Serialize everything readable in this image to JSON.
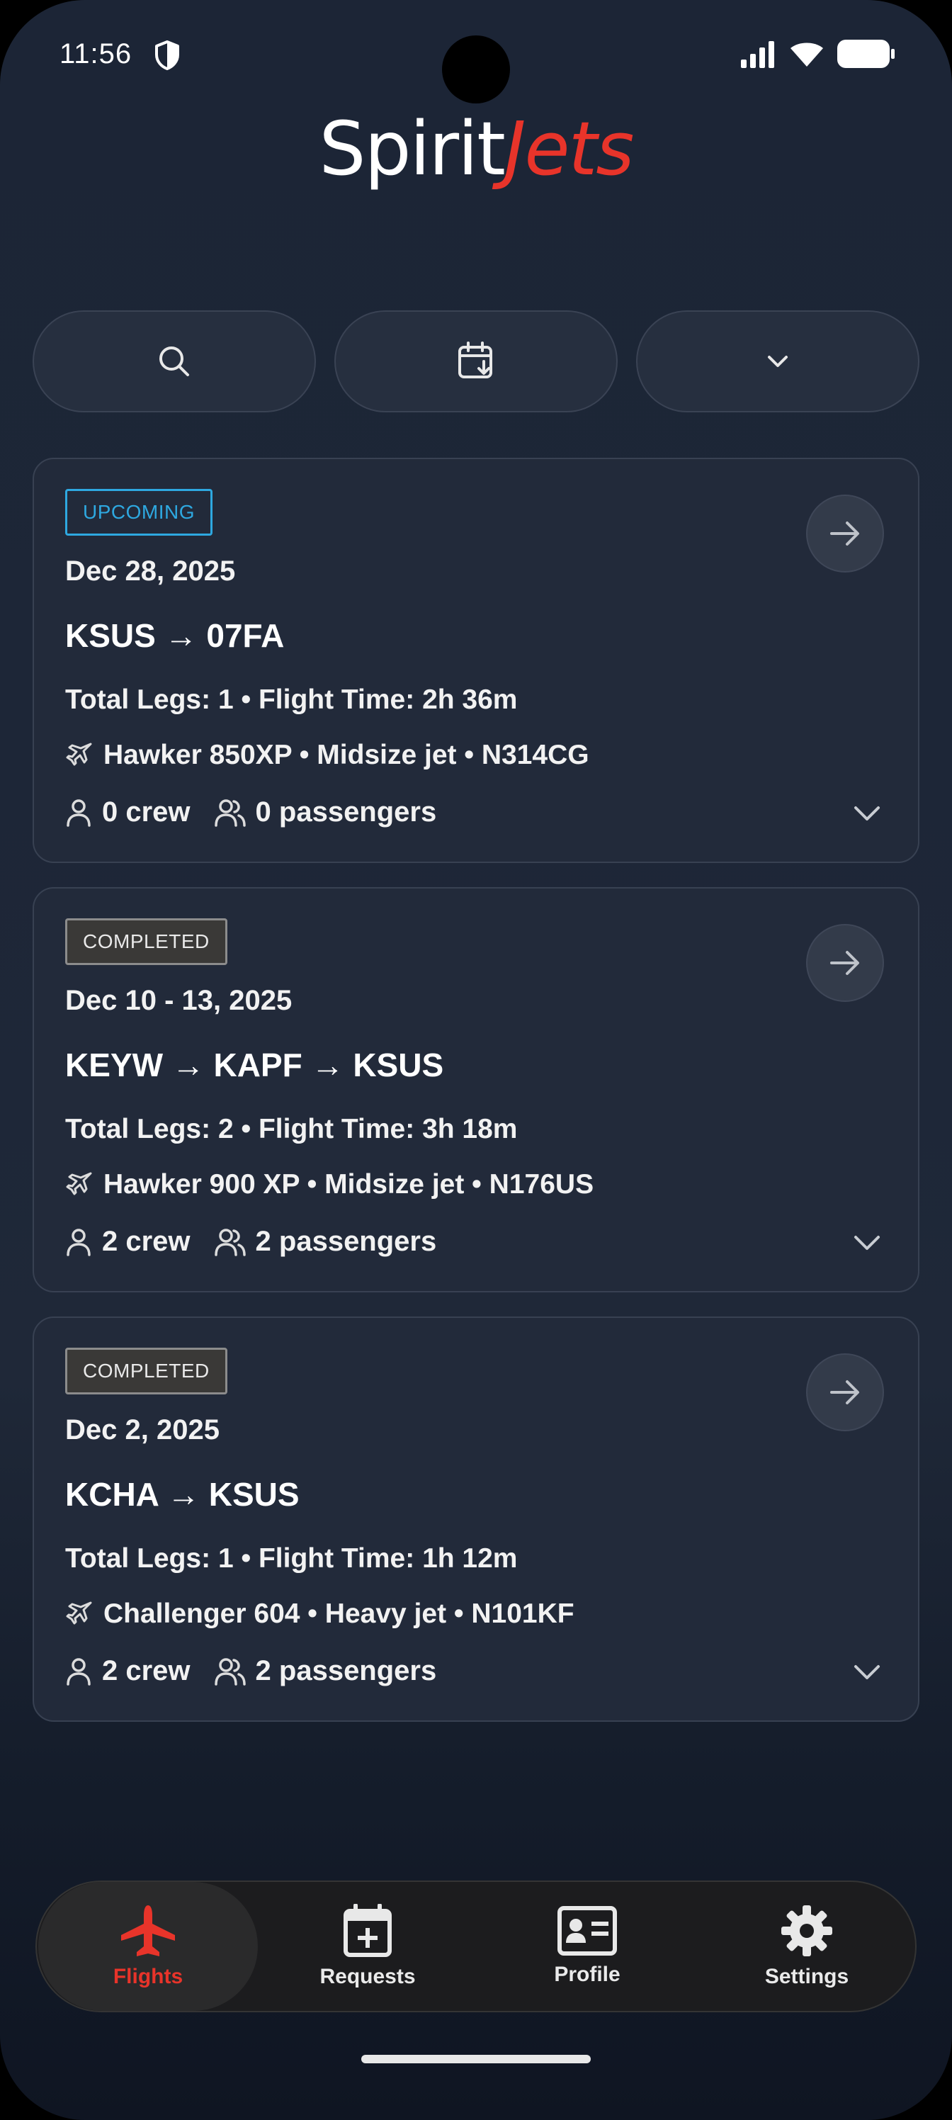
{
  "status_bar": {
    "time": "11:56"
  },
  "logo": {
    "part1": "Spirit",
    "part2": "Jets"
  },
  "filters": [
    {
      "icon": "search-icon"
    },
    {
      "icon": "calendar-icon"
    },
    {
      "icon": "chevron-down-icon"
    }
  ],
  "flights": [
    {
      "status": "UPCOMING",
      "date": "Dec 28, 2025",
      "route": "KSUS → 07FA",
      "legs_time": "Total Legs: 1 • Flight Time: 2h 36m",
      "aircraft": "Hawker 850XP • Midsize jet • N314CG",
      "crew": "0 crew",
      "passengers": "0 passengers"
    },
    {
      "status": "COMPLETED",
      "date": "Dec 10 - 13, 2025",
      "route": "KEYW → KAPF → KSUS",
      "legs_time": "Total Legs: 2 • Flight Time: 3h 18m",
      "aircraft": "Hawker 900 XP • Midsize jet • N176US",
      "crew": "2 crew",
      "passengers": "2 passengers"
    },
    {
      "status": "COMPLETED",
      "date": "Dec 2, 2025",
      "route": "KCHA → KSUS",
      "legs_time": "Total Legs: 1 • Flight Time: 1h 12m",
      "aircraft": "Challenger 604 • Heavy jet • N101KF",
      "crew": "2 crew",
      "passengers": "2 passengers"
    }
  ],
  "bottom_nav": [
    {
      "label": "Flights",
      "icon": "airplane-icon",
      "active": true
    },
    {
      "label": "Requests",
      "icon": "calendar-plus-icon",
      "active": false
    },
    {
      "label": "Profile",
      "icon": "id-card-icon",
      "active": false
    },
    {
      "label": "Settings",
      "icon": "gear-icon",
      "active": false
    }
  ],
  "colors": {
    "accent": "#e8342a",
    "upcoming": "#2ea8e0",
    "background": "#1d2637"
  }
}
